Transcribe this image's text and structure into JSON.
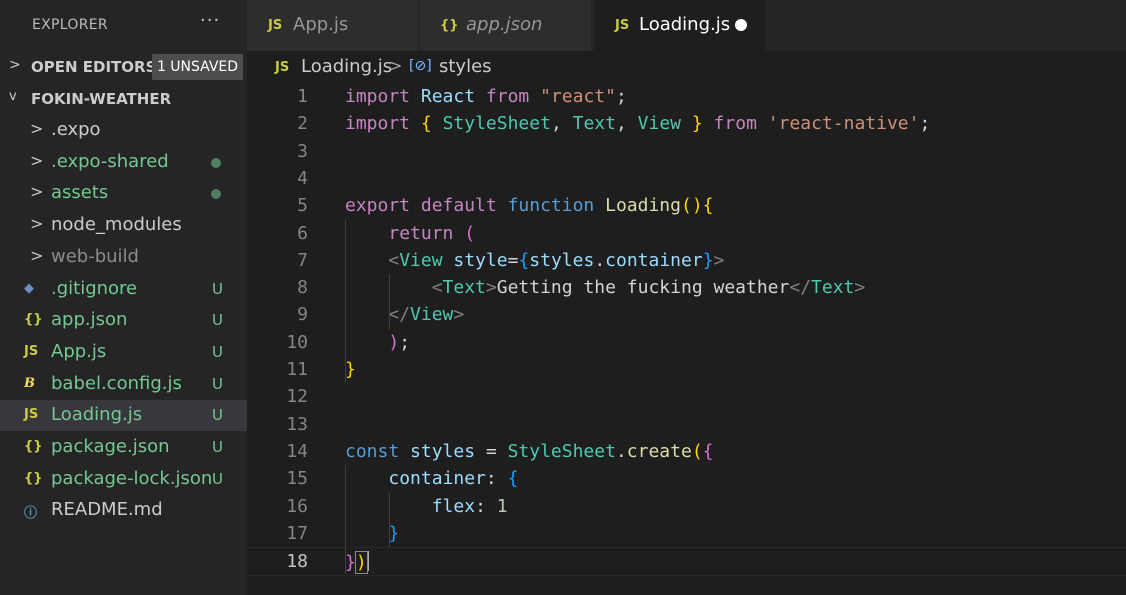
{
  "sidebar": {
    "title": "EXPLORER",
    "more_label": "···",
    "open_editors": {
      "label": "OPEN EDITORS",
      "badge": "1 UNSAVED",
      "chevron": ">"
    },
    "project": {
      "label": "FOKIN-WEATHER",
      "chevron": "v"
    },
    "items": [
      {
        "name": ".expo",
        "type": "folder",
        "chevron": ">"
      },
      {
        "name": ".expo-shared",
        "type": "folder",
        "chevron": ">",
        "dot": true
      },
      {
        "name": "assets",
        "type": "folder",
        "chevron": ">",
        "dot": true
      },
      {
        "name": "node_modules",
        "type": "folder",
        "chevron": ">"
      },
      {
        "name": "web-build",
        "type": "folder",
        "chevron": ">"
      },
      {
        "name": ".gitignore",
        "type": "file",
        "icon": "git-icon",
        "glyph": "◆",
        "status": "U"
      },
      {
        "name": "app.json",
        "type": "file",
        "icon": "json-icon",
        "glyph": "{}",
        "status": "U"
      },
      {
        "name": "App.js",
        "type": "file",
        "icon": "js-icon",
        "glyph": "JS",
        "status": "U"
      },
      {
        "name": "babel.config.js",
        "type": "file",
        "icon": "babel-icon",
        "glyph": "B",
        "status": "U"
      },
      {
        "name": "Loading.js",
        "type": "file",
        "icon": "js-icon",
        "glyph": "JS",
        "status": "U",
        "selected": true
      },
      {
        "name": "package.json",
        "type": "file",
        "icon": "json-icon",
        "glyph": "{}",
        "status": "U"
      },
      {
        "name": "package-lock.json",
        "type": "file",
        "icon": "json-icon",
        "glyph": "{}",
        "status": "U"
      },
      {
        "name": "README.md",
        "type": "file",
        "icon": "info-icon",
        "glyph": "ⓘ"
      }
    ]
  },
  "tabs": [
    {
      "label": "App.js",
      "icon": "js-icon",
      "glyph": "JS"
    },
    {
      "label": "app.json",
      "icon": "json-icon",
      "glyph": "{}",
      "italic": true
    },
    {
      "label": "Loading.js",
      "icon": "js-icon",
      "glyph": "JS",
      "active": true,
      "unsaved": true
    }
  ],
  "breadcrumb": {
    "file_icon": "JS",
    "file": "Loading.js",
    "separator": ">",
    "symbol_icon": "[⊘]",
    "symbol": "styles"
  },
  "editor": {
    "current_line": 18,
    "lines": [
      {
        "n": "1",
        "tokens": [
          [
            "kw",
            "import"
          ],
          [
            "pu",
            " "
          ],
          [
            "vr",
            "React"
          ],
          [
            "pu",
            " "
          ],
          [
            "kw",
            "from"
          ],
          [
            "pu",
            " "
          ],
          [
            "st",
            "\"react\""
          ],
          [
            "pu",
            ";"
          ]
        ]
      },
      {
        "n": "2",
        "tokens": [
          [
            "kw",
            "import"
          ],
          [
            "pu",
            " "
          ],
          [
            "br1",
            "{"
          ],
          [
            "pu",
            " "
          ],
          [
            "tp",
            "StyleSheet"
          ],
          [
            "pu",
            ", "
          ],
          [
            "tp",
            "Text"
          ],
          [
            "pu",
            ", "
          ],
          [
            "tp",
            "View"
          ],
          [
            "pu",
            " "
          ],
          [
            "br1",
            "}"
          ],
          [
            "pu",
            " "
          ],
          [
            "kw",
            "from"
          ],
          [
            "pu",
            " "
          ],
          [
            "st",
            "'react-native'"
          ],
          [
            "pu",
            ";"
          ]
        ]
      },
      {
        "n": "3",
        "tokens": []
      },
      {
        "n": "4",
        "tokens": []
      },
      {
        "n": "5",
        "tokens": [
          [
            "kw",
            "export"
          ],
          [
            "pu",
            " "
          ],
          [
            "kw",
            "default"
          ],
          [
            "pu",
            " "
          ],
          [
            "bl",
            "function"
          ],
          [
            "pu",
            " "
          ],
          [
            "fn",
            "Loading"
          ],
          [
            "br1",
            "()"
          ],
          [
            "br1",
            "{"
          ]
        ]
      },
      {
        "n": "6",
        "tokens": [
          [
            "pu",
            "    "
          ],
          [
            "kw",
            "return"
          ],
          [
            "pu",
            " "
          ],
          [
            "br2",
            "("
          ]
        ]
      },
      {
        "n": "7",
        "tokens": [
          [
            "pu",
            "    "
          ],
          [
            "tg",
            "<"
          ],
          [
            "tp",
            "View"
          ],
          [
            "pu",
            " "
          ],
          [
            "vr",
            "style"
          ],
          [
            "pu",
            "="
          ],
          [
            "br3",
            "{"
          ],
          [
            "vr",
            "styles"
          ],
          [
            "pu",
            "."
          ],
          [
            "vr",
            "container"
          ],
          [
            "br3",
            "}"
          ],
          [
            "tg",
            ">"
          ]
        ]
      },
      {
        "n": "8",
        "tokens": [
          [
            "pu",
            "        "
          ],
          [
            "tg",
            "<"
          ],
          [
            "tp",
            "Text"
          ],
          [
            "tg",
            ">"
          ],
          [
            "pu",
            "Getting the fucking weather"
          ],
          [
            "tg",
            "</"
          ],
          [
            "tp",
            "Text"
          ],
          [
            "tg",
            ">"
          ]
        ]
      },
      {
        "n": "9",
        "tokens": [
          [
            "pu",
            "    "
          ],
          [
            "tg",
            "</"
          ],
          [
            "tp",
            "View"
          ],
          [
            "tg",
            ">"
          ]
        ]
      },
      {
        "n": "10",
        "tokens": [
          [
            "pu",
            "    "
          ],
          [
            "br2",
            ")"
          ],
          [
            "pu",
            ";"
          ]
        ]
      },
      {
        "n": "11",
        "tokens": [
          [
            "br1",
            "}"
          ]
        ]
      },
      {
        "n": "12",
        "tokens": []
      },
      {
        "n": "13",
        "tokens": []
      },
      {
        "n": "14",
        "tokens": [
          [
            "bl",
            "const"
          ],
          [
            "pu",
            " "
          ],
          [
            "vr",
            "styles"
          ],
          [
            "pu",
            " = "
          ],
          [
            "tp",
            "StyleSheet"
          ],
          [
            "pu",
            "."
          ],
          [
            "fn",
            "create"
          ],
          [
            "br1",
            "("
          ],
          [
            "br2",
            "{"
          ]
        ]
      },
      {
        "n": "15",
        "tokens": [
          [
            "pu",
            "    "
          ],
          [
            "vr",
            "container"
          ],
          [
            "pu",
            ": "
          ],
          [
            "br3",
            "{"
          ]
        ]
      },
      {
        "n": "16",
        "tokens": [
          [
            "pu",
            "        "
          ],
          [
            "vr",
            "flex"
          ],
          [
            "pu",
            ": "
          ],
          [
            "nm",
            "1"
          ]
        ]
      },
      {
        "n": "17",
        "tokens": [
          [
            "pu",
            "    "
          ],
          [
            "br3",
            "}"
          ]
        ]
      },
      {
        "n": "18",
        "tokens": [
          [
            "br2",
            "}"
          ],
          [
            "br1",
            ")"
          ]
        ]
      }
    ]
  }
}
